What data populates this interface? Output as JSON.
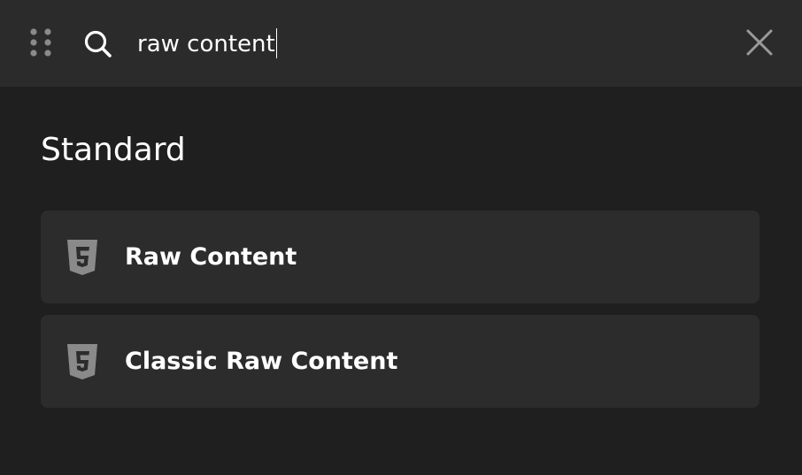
{
  "search": {
    "value": "raw content",
    "placeholder": ""
  },
  "icons": {
    "drag": "drag-handle-icon",
    "search": "search-icon",
    "close": "close-icon",
    "result": "html5-icon"
  },
  "section": {
    "title": "Standard"
  },
  "results": [
    {
      "label": "Raw Content",
      "icon": "html5-icon"
    },
    {
      "label": "Classic Raw Content",
      "icon": "html5-icon"
    }
  ],
  "colors": {
    "background": "#1f1f1f",
    "header": "#2b2b2b",
    "card": "#2c2c2c",
    "icon": "#8a8a8a",
    "text": "#ffffff"
  }
}
